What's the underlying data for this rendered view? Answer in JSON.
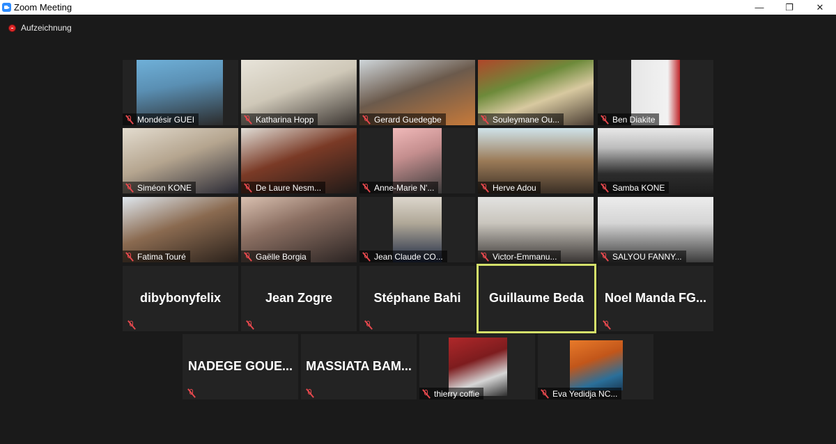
{
  "window": {
    "title": "Zoom Meeting",
    "minimize": "—",
    "maximize": "❐",
    "close": "✕"
  },
  "recording": {
    "label": "Aufzeichnung"
  },
  "participants": {
    "r1": [
      "Mondésir GUEI",
      "Katharina Hopp",
      "Gerard Guedegbe",
      "Souleymane Ou...",
      "Ben Diakite"
    ],
    "r2": [
      "Siméon KONE",
      "De Laure Nesm...",
      "Anne-Marie N'...",
      "Herve Adou",
      "Samba KONE"
    ],
    "r3": [
      "Fatima Touré",
      "Gaëlle Borgia",
      "Jean Claude CO...",
      "Victor-Emmanu...",
      "SALYOU FANNY..."
    ],
    "r4": [
      "dibybonyfelix",
      "Jean Zogre",
      "Stéphane Bahi",
      "Guillaume Beda",
      "Noel  Manda  FG..."
    ],
    "r5": [
      "NADEGE  GOUE...",
      "MASSIATA  BAM...",
      "thierry coffie",
      "Eva Yedidja NC..."
    ]
  },
  "active_speaker": "Guillaume Beda",
  "colors": {
    "active_border": "#d4e06a",
    "muted_mic": "#e5484d",
    "background": "#1a1a1a"
  }
}
